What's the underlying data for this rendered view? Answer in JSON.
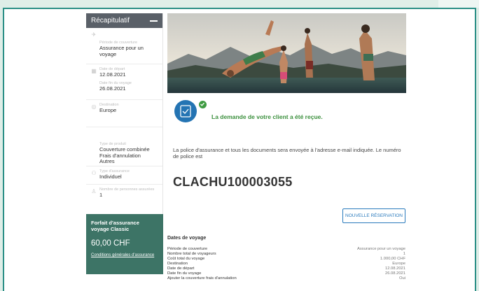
{
  "sidebar": {
    "title": "Récapitulatif",
    "sections": [
      {
        "fields": [
          {
            "label": "Période de couverture",
            "value": "Assurance pour un voyage"
          }
        ]
      },
      {
        "fields": [
          {
            "label": "Date de départ",
            "value": "12.08.2021"
          },
          {
            "label": "Date fin du voyage",
            "value": "26.08.2021"
          }
        ]
      },
      {
        "fields": [
          {
            "label": "Destination",
            "value": "Europe"
          }
        ]
      },
      {
        "fields": [
          {
            "label": "Type de produit",
            "value": "Couverture combinée Frais d'annulation Autres"
          }
        ]
      },
      {
        "fields": [
          {
            "label": "Type d'assurance",
            "value": "Individuel"
          }
        ]
      },
      {
        "fields": [
          {
            "label": "Nombre de personnes assurées",
            "value": "1"
          }
        ]
      }
    ],
    "package_title": "Forfait d'assurance voyage Classic",
    "price": "60,00 CHF",
    "conditions_link": "Conditions générales d'assurance"
  },
  "main": {
    "success_message": "La demande de votre client a été reçue.",
    "info_text": "La police d'assurance et tous les documents sera envoyée à l'adresse e-mail indiquée. Le numéro de police est",
    "policy_number": "CLACHU100003055",
    "new_button": "NOUVELLE RÉSERVATION",
    "dates_title": "Dates de voyage",
    "rows": [
      {
        "label": "Période de couverture",
        "value": "Assurance pour un voyage"
      },
      {
        "label": "Nombre total de voyageurs",
        "value": "1"
      },
      {
        "label": "Coût total du voyage",
        "value": "1.000,00 CHF"
      },
      {
        "label": "Destination",
        "value": "Europe"
      },
      {
        "label": "Date de départ",
        "value": "12.08.2021"
      },
      {
        "label": "Date fin du voyage",
        "value": "26.08.2021"
      },
      {
        "label": "Ajouter la couverture frais d'annulation",
        "value": "Oui"
      }
    ]
  },
  "colors": {
    "accent": "#2b7bbd",
    "sidebar_green": "#3d7466",
    "success": "#3a8f3c",
    "header_gray": "#5a6068"
  }
}
